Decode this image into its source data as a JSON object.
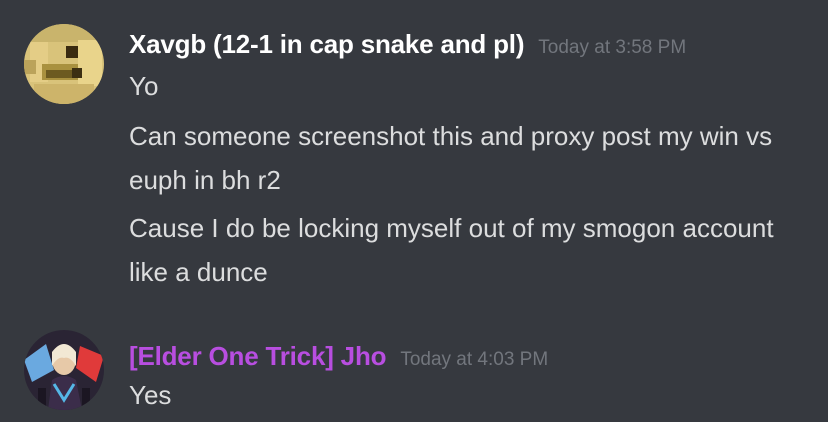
{
  "messages": [
    {
      "author": "Xavgb (12-1 in cap snake and pl)",
      "author_color": "#ffffff",
      "timestamp": "Today at 3:58 PM",
      "lines": [
        "Yo",
        "Can someone screenshot this and proxy post my win vs euph in bh r2",
        "Cause I do be locking myself out of my smogon account like a dunce"
      ]
    },
    {
      "author": "[Elder One Trick] Jho",
      "author_color": "#b84ee0",
      "timestamp": "Today at 4:03 PM",
      "lines": [
        "Yes"
      ]
    }
  ]
}
